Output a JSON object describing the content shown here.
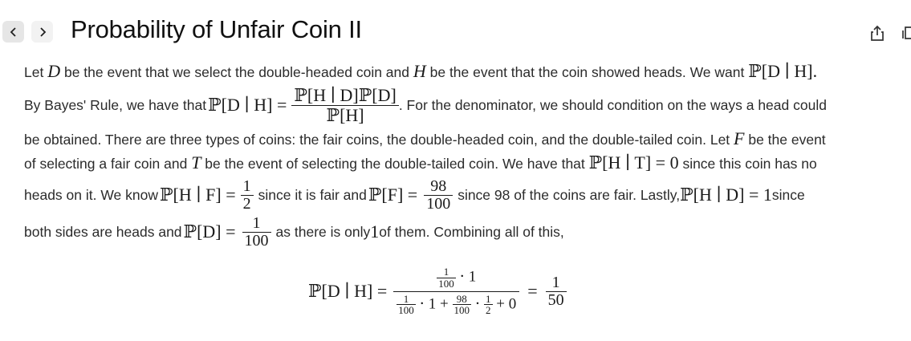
{
  "header": {
    "title": "Probability of Unfair Coin II",
    "back_label": "<",
    "forward_label": ">"
  },
  "text": {
    "l1a": "Let ",
    "l1b": " be the event that we select the double-headed coin and ",
    "l1c": " be the event that the coin showed heads. We want ",
    "l2a": "By Bayes' Rule, we have that ",
    "l2b": ". For the denominator, we should condition on the ways a head could",
    "l3": "be obtained. There are three types of coins: the fair coins, the double-headed coin, and the double-tailed coin. Let ",
    "l3b": " be the event",
    "l4a": "of selecting a fair coin and ",
    "l4b": " be the event of selecting the double-tailed coin. We have that ",
    "l4c": " since this coin has no",
    "l5a": "heads on it. We know ",
    "l5b": " since it is fair and ",
    "l5c": " since 98 of the coins are fair. Lastly, ",
    "l5d": " since",
    "l6a": "both sides are heads and ",
    "l6b": " as there is only ",
    "l6c": " of them. Combining all of this,"
  },
  "math": {
    "D": "D",
    "H": "H",
    "F": "F",
    "T": "T",
    "PDgH": "ℙ[D ∣ H].",
    "PDgH_eq": "ℙ[D ∣ H] =",
    "PHgDPD": "ℙ[H ∣ D]ℙ[D]",
    "PH": "ℙ[H]",
    "PHgT": "ℙ[H ∣ T] = 0",
    "PHgF": "ℙ[H ∣ F] =",
    "PF": "ℙ[F] =",
    "PHgD_one": "ℙ[H ∣ D] = 1",
    "PD": "ℙ[D] =",
    "one": "1",
    "two": "2",
    "hundred": "100",
    "ninety_eight": "98",
    "fifty": "50",
    "final_lhs": "ℙ[D ∣ H] =",
    "dot_one": "⋅ 1",
    "denom_part1": "⋅ 1 +",
    "dot": "⋅",
    "plus_zero": "+ 0",
    "equals": "="
  }
}
